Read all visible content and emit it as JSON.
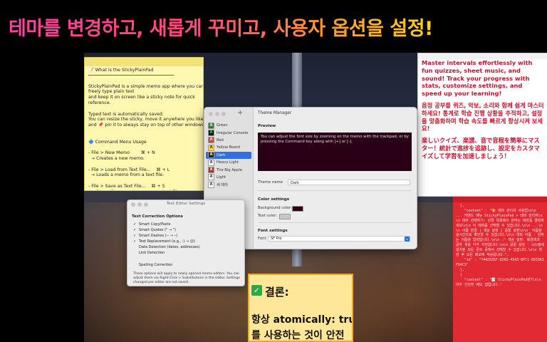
{
  "headline": "테마를 변경하고, 새롭게 꾸미고, 사용자 옵션을 설정!",
  "yellow_sticky": {
    "lines": [
      "📝 What is the StickyPlainPad",
      "",
      "StickyPlainPad is a simple memo app where you can",
      "freely type plain text",
      "and keep it on screen like a sticky note for quick",
      "reference.",
      "",
      "Typed text is automatically saved.",
      "You can resize the sticky, move it anywhere you like,",
      "and 📌 pin it to always stay on top of other windows.",
      "",
      "",
      "🔷 Command Menu Usage",
      "",
      "- File > New Memo        ⌘ + N",
      "  → Creates a new memo.",
      "",
      "- File > Load from Text File...    ⌘ + L",
      "  → Loads a memo from a text file.",
      "",
      "- File > Save as Text File...    ⌘ + S",
      "  → Saves the current memo as a text file."
    ]
  },
  "white_sticky": {
    "en": "Master intervals effortlessly with fun quizzes, sheet music, and sound! Track your progress with stats, customize settings, and speed up your learning!",
    "ko": "음정 공부를 퀴즈, 악보, 소리와 함께 쉽게 마스터하세요! 통계로 학습 진행 상황을 추적하고, 설정을 맞춤화하며 학습 속도를 빠르게 향상시켜 보세요!",
    "ja": "楽しいクイズ、楽譜、音で音程を簡単にマスター！統計で進捗を追跡し、設定をカスタマイズして学習を加速しましょう！"
  },
  "theme_manager": {
    "title": "Theme Manager",
    "themes": [
      {
        "label": "Green",
        "badge": "A",
        "bg": "#2e7d32",
        "fg": "#ffffff",
        "selected": false
      },
      {
        "label": "Irregular Console",
        "badge": "A",
        "bg": "#111111",
        "fg": "#39ff14",
        "selected": false
      },
      {
        "label": "Red",
        "badge": "A",
        "bg": "#e53935",
        "fg": "#ffffff",
        "selected": false
      },
      {
        "label": "Yellow Board",
        "badge": "A",
        "bg": "#fdd835",
        "fg": "#333333",
        "selected": false
      },
      {
        "label": "Dark",
        "badge": "A",
        "bg": "#222222",
        "fg": "#ffffff",
        "selected": true
      },
      {
        "label": "Heavy Light",
        "badge": "A",
        "bg": "#ffffff",
        "fg": "#333333",
        "selected": false
      },
      {
        "label": "The Big Apple",
        "badge": "A",
        "bg": "#c62828",
        "fg": "#ffffff",
        "selected": false
      },
      {
        "label": "Light",
        "badge": "A",
        "bg": "#fafafa",
        "fg": "#333333",
        "selected": false
      },
      {
        "label": "새 테마",
        "badge": "A",
        "bg": "#ffffff",
        "fg": "#333333",
        "selected": false
      }
    ],
    "preview_label": "Preview",
    "preview_text": "You can adjust the font size by zooming on the memo with the trackpad, or by pressing the Command key along with [+] or [-].",
    "theme_name_label": "Theme name",
    "theme_name_value": "Dark",
    "color_settings_label": "Color settings",
    "background_color_label": "Background color:",
    "background_color": "#2a0017",
    "text_color_label": "Text color:",
    "text_color": "#c8c8c8",
    "font_settings_label": "Font settings",
    "font_label": "Font",
    "font_value": "SF Pro"
  },
  "text_editor_settings": {
    "title": "Text Editor Settings",
    "header": "Text Correction Options",
    "options": [
      {
        "label": "Smart Copy/Paste",
        "checked": true
      },
      {
        "label": "Smart Quotes (\" → \")",
        "checked": true
      },
      {
        "label": "Smart Dashes (-- → –)",
        "checked": true
      },
      {
        "label": "Text Replacement (e.g., :) → 😊)",
        "checked": true
      },
      {
        "label": "Data Detection (dates, addresses)",
        "checked": false
      },
      {
        "label": "Link Detection",
        "checked": false
      },
      {
        "label": "",
        "checked": false
      },
      {
        "label": "Spelling Correction",
        "checked": false
      }
    ],
    "note": "These options will apply to newly opened memo editors. You can adjust them via Right-Click > Substitutions in the editor. Settings changed per editor are not saved."
  },
  "orange_sticky": {
    "check": "✓",
    "conclusion": "결론:",
    "line1": "항상 atomically: true",
    "line2": "를 사용하는 것이 안전"
  },
  "red_sticky": {
    "code": "  },\n    \"content\" : \"🎨 테마 관리자 사용법\\n\\n  ... 커맨드 메뉴 StickyPlainPad > 테마 관리자\\n\\n 테마 선택하기: 왼쪽 목록에서 원하는 테마를 클릭하세요\\n\\n 이 테마를 선택할 수 있습니다.\\n\\n ...\\n\\n 이름 변경 | 색상 설정 | 글꼴 설정\\n\\n  이름을 실시간으로 확인할 수 있습니다.\\n\\n 테마 이름 · 원하는 이름을 입력합니다.\\n\\n 📌 색상 설정: 배경색과 글자 색을 각각 지정합니다.\\n\\n 글꼴 설정 · 시스템에 설치된 모든 폰트 중에서 선택할 수 있습니다.\\n\\n 저장 후 모든 메모에 적용됩니다.\",\n    \"id\" : \"7442835F-D265-4543-BFC1-6D33A1F64C3\"\n  },\n  {\n    \"content\" : \"📝 StickyPlainPad란?\\n\\n 아주 간단한 메모 앱입니다.\""
  }
}
